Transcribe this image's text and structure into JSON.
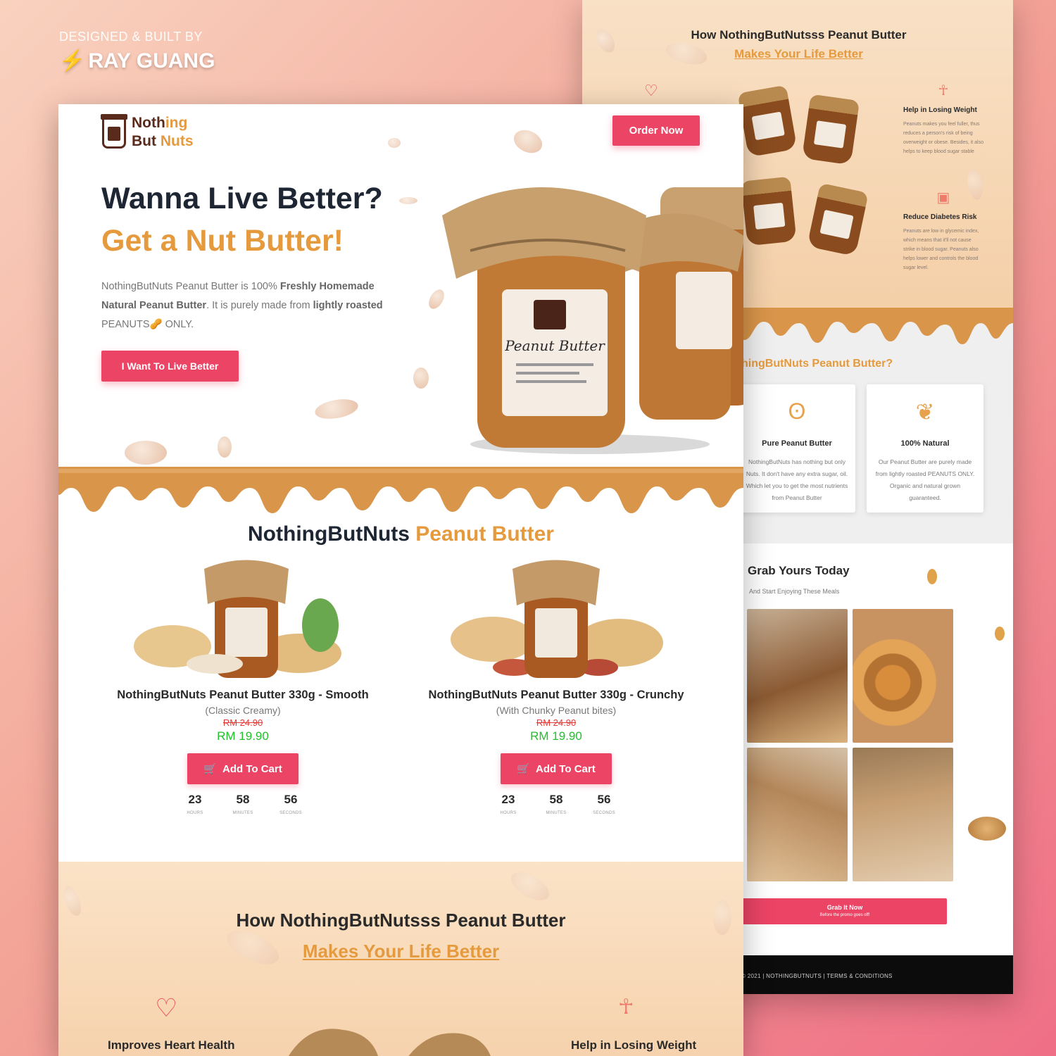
{
  "credit": {
    "line1": "DESIGNED & BUILT BY",
    "line2": "RAY GUANG"
  },
  "front": {
    "logo": {
      "line1a": "Noth",
      "line1b": "ing",
      "line2a": "But ",
      "line2b": "Nuts"
    },
    "order_btn": "Order Now",
    "hero": {
      "title": "Wanna Live Better?",
      "title2": "Get a Nut Butter!",
      "desc_a": "NothingButNuts Peanut Butter is 100% ",
      "desc_b": "Freshly Homemade Natural Peanut Butter",
      "desc_c": ". It is purely made from ",
      "desc_d": "lightly roasted",
      "desc_e": " PEANUTS🥜 ONLY.",
      "cta": "I Want To Live Better"
    },
    "section_title_a": "NothingButNuts ",
    "section_title_b": "Peanut Butter",
    "products": [
      {
        "name": "NothingButNuts Peanut Butter 330g - Smooth",
        "variant": "(Classic Creamy)",
        "old_price": "RM 24.90",
        "price": "RM 19.90",
        "cart": "Add To Cart",
        "timer": {
          "hours": "23",
          "minutes": "58",
          "seconds": "56",
          "hours_label": "HOURS",
          "minutes_label": "MINUTES",
          "seconds_label": "SECONDS"
        }
      },
      {
        "name": "NothingButNuts Peanut Butter 330g - Crunchy",
        "variant": "(With Chunky Peanut bites)",
        "old_price": "RM 24.90",
        "price": "RM 19.90",
        "cart": "Add To Cart",
        "timer": {
          "hours": "23",
          "minutes": "58",
          "seconds": "56",
          "hours_label": "HOURS",
          "minutes_label": "MINUTES",
          "seconds_label": "SECONDS"
        }
      }
    ],
    "benefits": {
      "title": "How NothingButNutsss Peanut Butter",
      "subtitle": "Makes Your Life Better",
      "heart": "Improves Heart Health",
      "weight": "Help in Losing Weight"
    }
  },
  "back": {
    "title": "How NothingButNutsss Peanut Butter",
    "subtitle": "Makes Your Life Better",
    "features": [
      {
        "title": "Help in Losing Weight",
        "text": "Peanuts makes you feel fuller, thus reduces a person's risk of being overweight or obese. Besides, it also helps to keep blood sugar stable"
      },
      {
        "title": "Reduce Diabetes Risk",
        "text": "Peanuts are low in glycemic index, which means that it'll not cause strike in blood sugar. Peanuts also helps lower and controls the blood sugar level."
      }
    ],
    "why_title": "hingButNuts Peanut Butter?",
    "cards": [
      {
        "title": "Pure Peanut Butter",
        "text": "NothingButNuts has nothing but only Nuts. It don't have any extra sugar, oil. Which let you to get the most nutrients from Peanut Butter"
      },
      {
        "title": "100% Natural",
        "text": "Our Peanut Butter are purely made from lightly roasted PEANUTS ONLY. Organic and natural grown guaranteed."
      }
    ],
    "grab_title": "Grab Yours Today",
    "grab_sub": "And Start Enjoying These Meals",
    "grab_btn": "Grab It Now",
    "grab_btn_sub": "Before the promo goes off!",
    "footer": "© 2021 | NOTHINGBUTNUTS | TERMS & CONDITIONS"
  },
  "colors": {
    "accent": "#ec4465",
    "brand": "#e59a3d",
    "price": "#22c02a",
    "old_price": "#e53935"
  }
}
